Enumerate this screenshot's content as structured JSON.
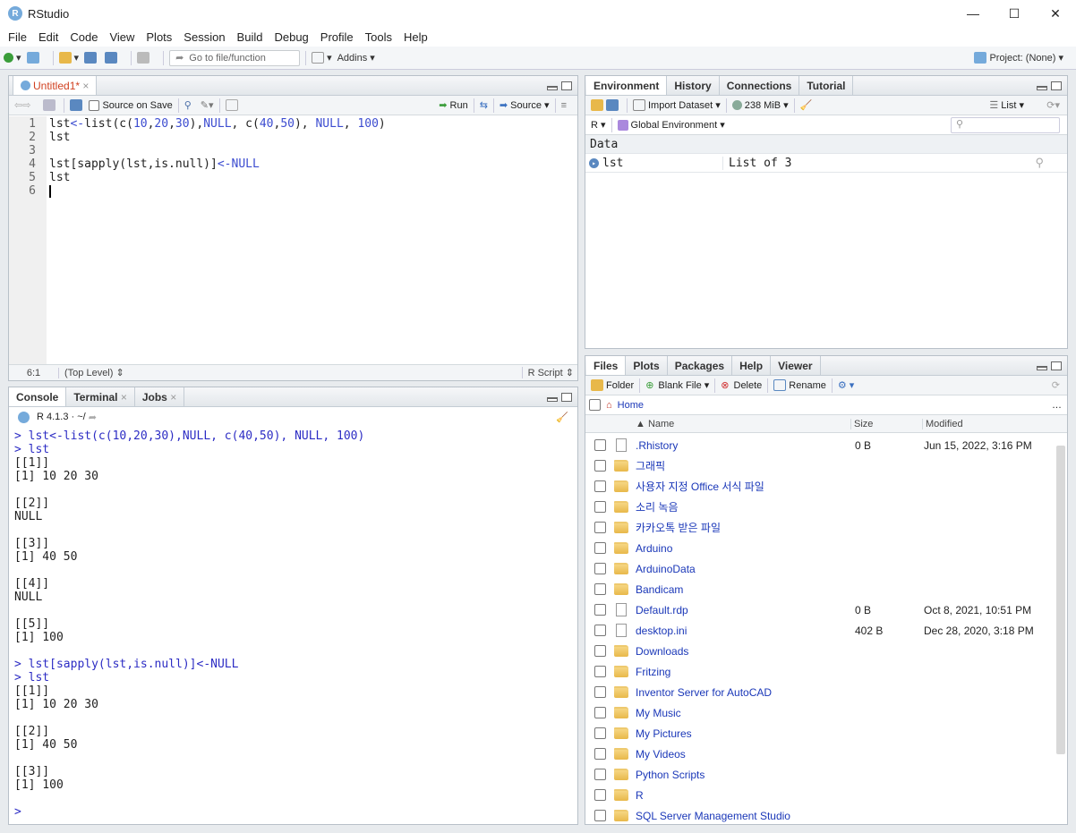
{
  "window": {
    "title": "RStudio",
    "min": "—",
    "max": "☐",
    "close": "✕"
  },
  "menu": [
    "File",
    "Edit",
    "Code",
    "View",
    "Plots",
    "Session",
    "Build",
    "Debug",
    "Profile",
    "Tools",
    "Help"
  ],
  "toolbar": {
    "goto_placeholder": "Go to file/function",
    "addins": "Addins",
    "project": "Project: (None)"
  },
  "editor": {
    "tab": "Untitled1*",
    "source_on_save": "Source on Save",
    "run": "Run",
    "source": "Source",
    "cursor_pos": "6:1",
    "scope": "(Top Level)",
    "file_type": "R Script",
    "line_numbers": [
      "1",
      "2",
      "3",
      "4",
      "5",
      "6"
    ]
  },
  "console": {
    "tabs": [
      "Console",
      "Terminal",
      "Jobs"
    ],
    "version": "R 4.1.3",
    "path": "· ~/",
    "lines": [
      {
        "t": "> lst<-list(c(10,20,30),NULL, c(40,50), NULL, 100)",
        "cmd": true
      },
      {
        "t": "> lst",
        "cmd": true
      },
      {
        "t": "[[1]]"
      },
      {
        "t": "[1] 10 20 30"
      },
      {
        "t": ""
      },
      {
        "t": "[[2]]"
      },
      {
        "t": "NULL"
      },
      {
        "t": ""
      },
      {
        "t": "[[3]]"
      },
      {
        "t": "[1] 40 50"
      },
      {
        "t": ""
      },
      {
        "t": "[[4]]"
      },
      {
        "t": "NULL"
      },
      {
        "t": ""
      },
      {
        "t": "[[5]]"
      },
      {
        "t": "[1] 100"
      },
      {
        "t": ""
      },
      {
        "t": "> lst[sapply(lst,is.null)]<-NULL",
        "cmd": true
      },
      {
        "t": "> lst",
        "cmd": true
      },
      {
        "t": "[[1]]"
      },
      {
        "t": "[1] 10 20 30"
      },
      {
        "t": ""
      },
      {
        "t": "[[2]]"
      },
      {
        "t": "[1] 40 50"
      },
      {
        "t": ""
      },
      {
        "t": "[[3]]"
      },
      {
        "t": "[1] 100"
      },
      {
        "t": ""
      },
      {
        "t": "> ",
        "cmd": true
      }
    ]
  },
  "environment": {
    "tabs": [
      "Environment",
      "History",
      "Connections",
      "Tutorial"
    ],
    "import": "Import Dataset",
    "memory": "238 MiB",
    "view": "List",
    "lang": "R",
    "scope": "Global Environment",
    "section": "Data",
    "var_name": "lst",
    "var_value": "List of  3"
  },
  "files": {
    "tabs": [
      "Files",
      "Plots",
      "Packages",
      "Help",
      "Viewer"
    ],
    "folder": "Folder",
    "blank": "Blank File",
    "delete": "Delete",
    "rename": "Rename",
    "home": "Home",
    "col_name": "Name",
    "col_size": "Size",
    "col_modified": "Modified",
    "rows": [
      {
        "name": ".Rhistory",
        "size": "0 B",
        "mod": "Jun 15, 2022, 3:16 PM",
        "type": "history"
      },
      {
        "name": "그래픽",
        "size": "",
        "mod": "",
        "type": "folder"
      },
      {
        "name": "사용자 지정 Office 서식 파일",
        "size": "",
        "mod": "",
        "type": "folder"
      },
      {
        "name": "소리 녹음",
        "size": "",
        "mod": "",
        "type": "folder"
      },
      {
        "name": "카카오톡 받은 파일",
        "size": "",
        "mod": "",
        "type": "folder"
      },
      {
        "name": "Arduino",
        "size": "",
        "mod": "",
        "type": "folder"
      },
      {
        "name": "ArduinoData",
        "size": "",
        "mod": "",
        "type": "folder"
      },
      {
        "name": "Bandicam",
        "size": "",
        "mod": "",
        "type": "folder"
      },
      {
        "name": "Default.rdp",
        "size": "0 B",
        "mod": "Oct 8, 2021, 10:51 PM",
        "type": "file"
      },
      {
        "name": "desktop.ini",
        "size": "402 B",
        "mod": "Dec 28, 2020, 3:18 PM",
        "type": "ini"
      },
      {
        "name": "Downloads",
        "size": "",
        "mod": "",
        "type": "folder"
      },
      {
        "name": "Fritzing",
        "size": "",
        "mod": "",
        "type": "folder"
      },
      {
        "name": "Inventor Server for AutoCAD",
        "size": "",
        "mod": "",
        "type": "folder"
      },
      {
        "name": "My Music",
        "size": "",
        "mod": "",
        "type": "folder"
      },
      {
        "name": "My Pictures",
        "size": "",
        "mod": "",
        "type": "folder"
      },
      {
        "name": "My Videos",
        "size": "",
        "mod": "",
        "type": "folder"
      },
      {
        "name": "Python Scripts",
        "size": "",
        "mod": "",
        "type": "folder"
      },
      {
        "name": "R",
        "size": "",
        "mod": "",
        "type": "folder"
      },
      {
        "name": "SQL Server Management Studio",
        "size": "",
        "mod": "",
        "type": "folder"
      }
    ]
  }
}
